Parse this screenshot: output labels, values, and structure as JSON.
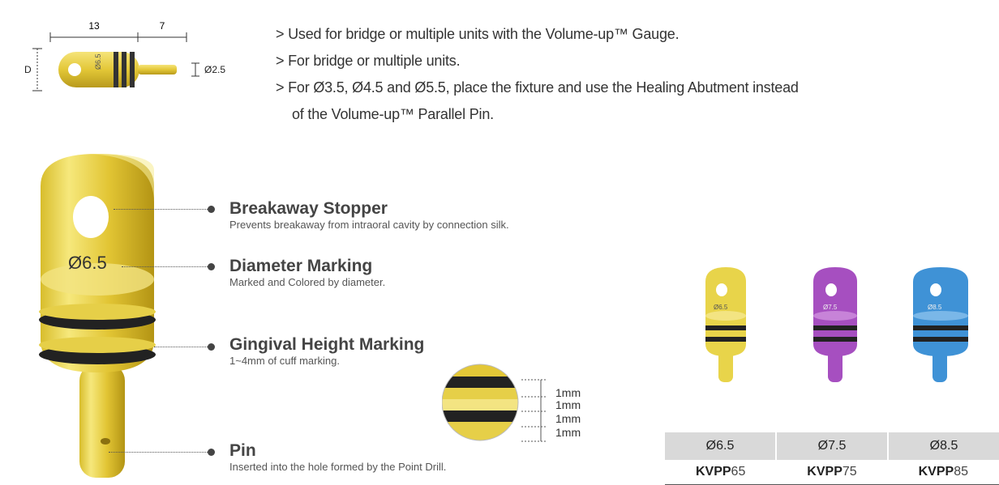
{
  "schematic": {
    "dim_length_head": "13",
    "dim_length_pin": "7",
    "dim_diameter_label": "D",
    "dim_pin_diameter": "Ø2.5",
    "head_marking": "Ø6.5"
  },
  "bullets": [
    {
      "text": "> Used for bridge or multiple units with the Volume-up™ Gauge."
    },
    {
      "text": "> For bridge or multiple units."
    },
    {
      "text": "> For Ø3.5, Ø4.5 and Ø5.5, place the fixture and use the Healing Abutment instead",
      "continuation": "of the Volume-up™ Parallel Pin."
    }
  ],
  "main_pin": {
    "marking": "Ø6.5"
  },
  "callouts": {
    "breakaway": {
      "title": "Breakaway Stopper",
      "desc": "Prevents breakaway from intraoral cavity by connection silk."
    },
    "diameter": {
      "title": "Diameter Marking",
      "desc": "Marked and Colored by diameter."
    },
    "gingival": {
      "title": "Gingival Height  Marking",
      "desc": "1~4mm of cuff marking."
    },
    "pin": {
      "title": "Pin",
      "desc": "Inserted into the  hole formed by the Point Drill."
    }
  },
  "detail_scale": [
    "1mm",
    "1mm",
    "1mm",
    "1mm"
  ],
  "products": [
    {
      "diameter": "Ø6.5",
      "code_prefix": "KVPP",
      "code_num": "65",
      "color": "#e8d44a",
      "marking": "Ø6.5"
    },
    {
      "diameter": "Ø7.5",
      "code_prefix": "KVPP",
      "code_num": "75",
      "color": "#a64fc0",
      "marking": "Ø7.5"
    },
    {
      "diameter": "Ø8.5",
      "code_prefix": "KVPP",
      "code_num": "85",
      "color": "#3f92d6",
      "marking": "Ø8.5"
    }
  ]
}
